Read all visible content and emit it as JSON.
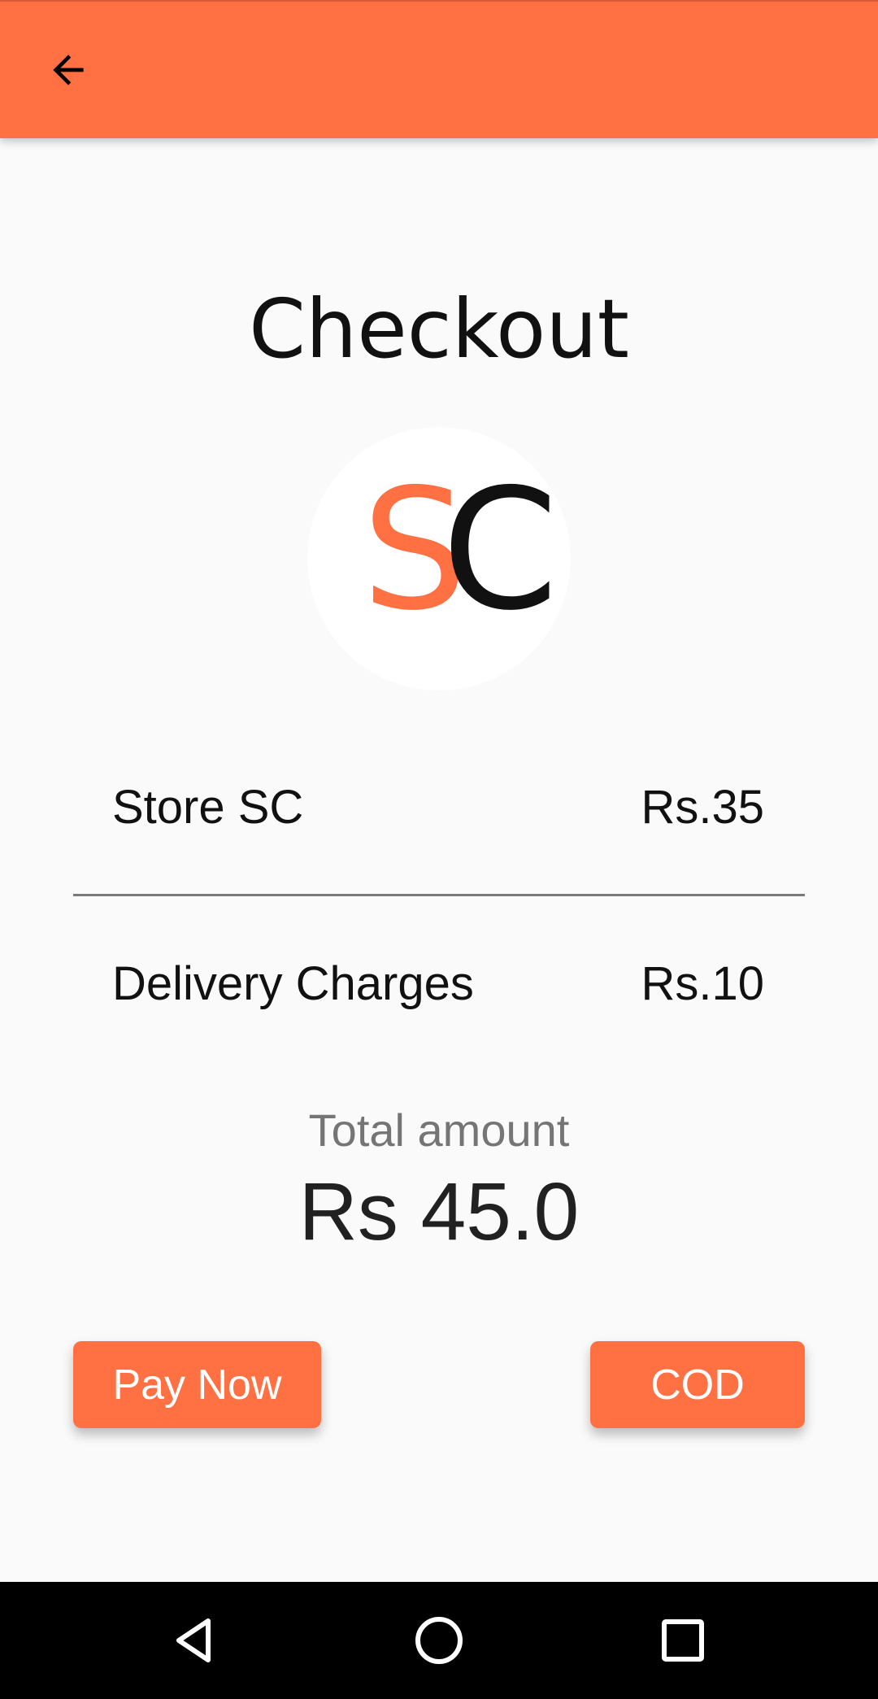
{
  "app_bar": {
    "color": "#ff7043",
    "back_icon": "arrow-left-icon"
  },
  "page": {
    "title": "Checkout"
  },
  "logo": {
    "letter_1": "S",
    "letter_2": "C",
    "letter_1_color": "#ff7043",
    "letter_2_color": "#111111"
  },
  "items": [
    {
      "label": "Store SC",
      "value": "Rs.35"
    },
    {
      "label": "Delivery Charges",
      "value": "Rs.10"
    }
  ],
  "total": {
    "label": "Total amount",
    "value": "Rs 45.0"
  },
  "actions": {
    "pay_now_label": "Pay Now",
    "cod_label": "COD",
    "accent": "#ff7043"
  },
  "system_nav": {
    "back_icon": "nav-back-triangle-icon",
    "home_icon": "nav-home-circle-icon",
    "recents_icon": "nav-recents-square-icon"
  }
}
